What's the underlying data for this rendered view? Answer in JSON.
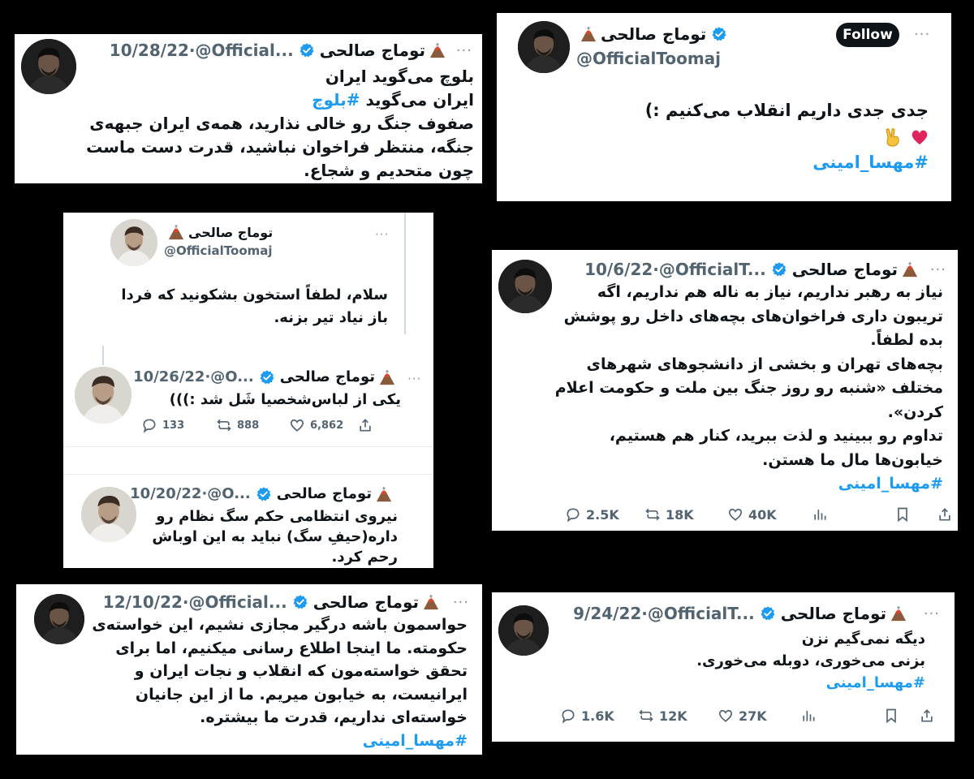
{
  "user": {
    "name": "توماج صالحی",
    "handle_full": "@OfficialToomaj"
  },
  "colors": {
    "hashtag": "#1d9bf0",
    "verified": "#1d9bf0",
    "background": "#000000",
    "follow_button": "#0f1419"
  },
  "icons": [
    "verified-badge-icon",
    "volcano-emoji-icon",
    "more-icon",
    "reply-icon",
    "retweet-icon",
    "like-icon",
    "views-icon",
    "bookmark-icon",
    "share-icon",
    "heart-emoji-icon",
    "victory-hand-emoji-icon"
  ],
  "tweets": {
    "t1": {
      "handle": "@Official...",
      "date": "10/28/22",
      "lines": [
        "بلوچ می‌گوید ایران",
        "ایران می‌گوید ",
        "صفوف جنگ رو خالی نذارید، همه‌ی ایران جبهه‌ی",
        "جنگه، منتظر فراخوان نباشید، قدرت دست ماست",
        "چون متحدیم و شجاع."
      ],
      "hashtag": "#بلوچ"
    },
    "t2": {
      "follow_label": "Follow",
      "lines": [
        "جدی جدی داریم انقلاب می‌کنیم :)"
      ],
      "hashtag": "#مهسا_امینی"
    },
    "t3": {
      "lines": [
        "سلام، لطفاً استخون بشکونید که فردا",
        "باز نیاد تیر بزنه."
      ]
    },
    "t4": {
      "handle": "@O...",
      "date": "10/26/22",
      "lines": [
        "یکی از لباس‌شخصیا شَل شد :)))"
      ],
      "replies": "133",
      "retweets": "888",
      "likes": "6,862"
    },
    "t5": {
      "handle": "@O...",
      "date": "10/20/22",
      "lines": [
        "نیروی انتظامی حکم سگ نظام رو",
        "داره(حیفِ سگ) نباید به این اوباش",
        "رحم کرد."
      ]
    },
    "t6": {
      "handle": "@OfficialT...",
      "date": "10/6/22",
      "lines": [
        "نیاز به رهبر نداریم، نیاز به ناله هم نداریم، اگه",
        "تریبون داری فراخوان‌های بچه‌های داخل رو پوشش",
        "بده لطفاً.",
        "بچه‌های تهران و بخشی از دانشجوهای شهرهای",
        "مختلف «شنبه رو روز جنگ بین ملت و حکومت اعلام",
        "کردن».",
        "تداوم رو ببینید و لذت ببرید، کنار هم هستیم،",
        "خیابون‌ها مال ما هستن."
      ],
      "hashtag": "#مهسا_امینی",
      "replies": "2.5K",
      "retweets": "18K",
      "likes": "40K"
    },
    "t7": {
      "handle": "@Official...",
      "date": "12/10/22",
      "lines": [
        "حواسمون باشه درگیر مجازی نشیم، این خواسته‌ی",
        "حکومته. ما اینجا اطلاع رسانی میکنیم، اما برای",
        "تحقق خواسته‌مون که انقلاب و نجات ایران و",
        "ایرانیست، به خیابون میریم. ما از این جانیان",
        "خواسته‌ای نداریم، قدرت ما بیشتره."
      ],
      "hashtag": "#مهسا_امینی"
    },
    "t8": {
      "handle": "@OfficialT...",
      "date": "9/24/22",
      "lines": [
        "دیگه نمی‌گیم نزن",
        "بزنی می‌خوری، دوبله می‌خوری."
      ],
      "hashtag": "#مهسا_امینی",
      "replies": "1.6K",
      "retweets": "12K",
      "likes": "27K"
    }
  }
}
